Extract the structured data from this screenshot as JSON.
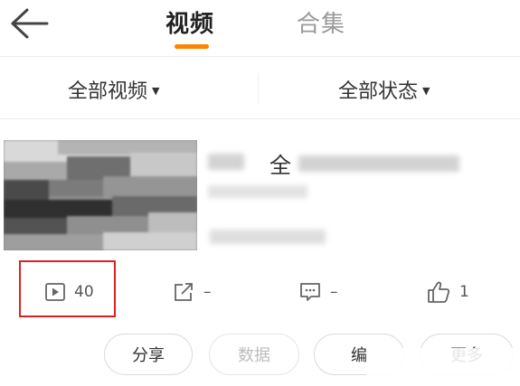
{
  "header": {
    "back_icon": "arrow-left-icon",
    "tabs": [
      {
        "label": "视频",
        "active": true
      },
      {
        "label": "合集",
        "active": false
      }
    ],
    "accent_color": "#ff8200"
  },
  "filters": {
    "video_filter": "全部视频",
    "status_filter": "全部状态",
    "dropdown_icon": "caret-down-icon"
  },
  "video_item": {
    "title_visible_char": "全",
    "title_blurred": true,
    "thumbnail_blurred": true
  },
  "stats": {
    "plays": {
      "icon": "play-icon",
      "value": "40"
    },
    "shares": {
      "icon": "share-icon",
      "value": "–"
    },
    "comments": {
      "icon": "comment-icon",
      "value": "–"
    },
    "likes": {
      "icon": "thumbs-up-icon",
      "value": "1"
    },
    "highlight_color": "#e02020"
  },
  "actions": {
    "share": "分享",
    "data": "数据",
    "edit": "编",
    "more": "更多"
  }
}
